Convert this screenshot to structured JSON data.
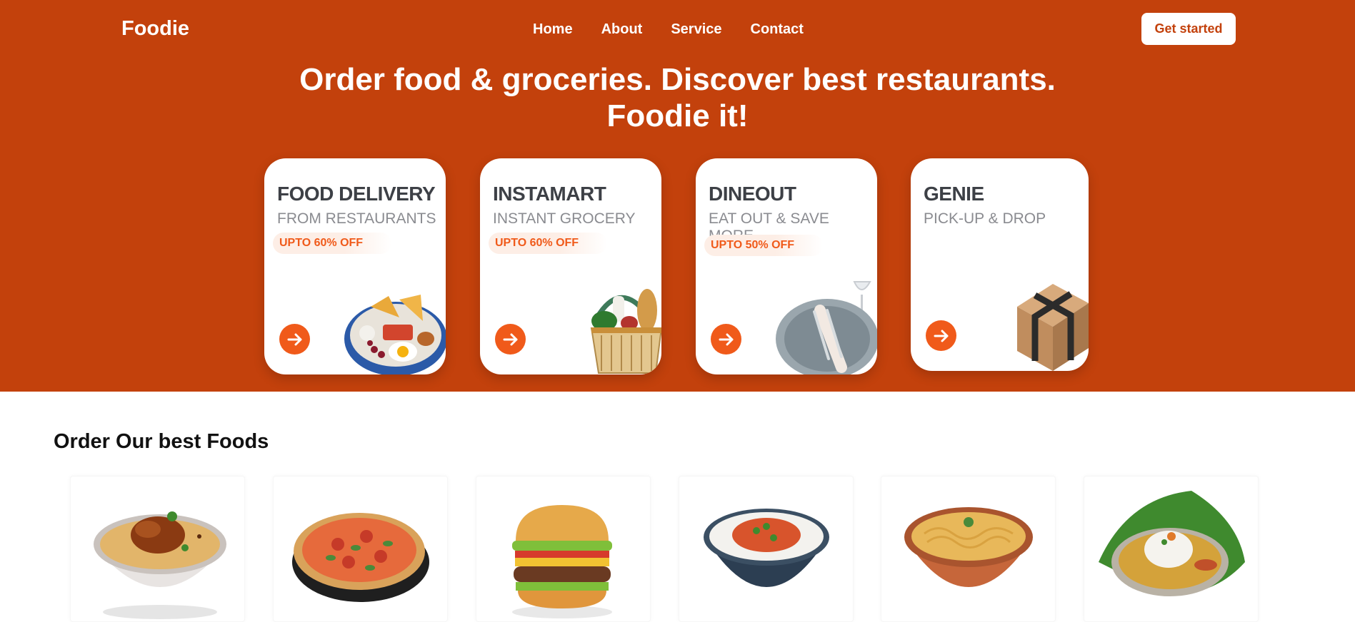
{
  "nav": {
    "brand": "Foodie",
    "links": [
      "Home",
      "About",
      "Service",
      "Contact"
    ],
    "cta_label": "Get started"
  },
  "hero": {
    "title_line1": "Order food & groceries. Discover best restaurants.",
    "title_line2": "Foodie it!"
  },
  "services": [
    {
      "title": "FOOD DELIVERY",
      "subtitle": "FROM RESTAURANTS",
      "offer": "UPTO 60% OFF",
      "icon": "arrow-right-icon"
    },
    {
      "title": "INSTAMART",
      "subtitle": "INSTANT GROCERY",
      "offer": "UPTO 60% OFF",
      "icon": "arrow-right-icon"
    },
    {
      "title": "DINEOUT",
      "subtitle": "EAT OUT & SAVE MORE",
      "offer": "UPTO 50% OFF",
      "icon": "arrow-right-icon"
    },
    {
      "title": "GENIE",
      "subtitle": "PICK-UP & DROP",
      "offer": "",
      "icon": "arrow-right-icon"
    }
  ],
  "foods_section": {
    "title": "Order Our best Foods"
  },
  "colors": {
    "brand": "#c3410c",
    "accent": "#f05a1a",
    "card_title": "#3d4046",
    "card_subtitle": "#8a8b90"
  }
}
